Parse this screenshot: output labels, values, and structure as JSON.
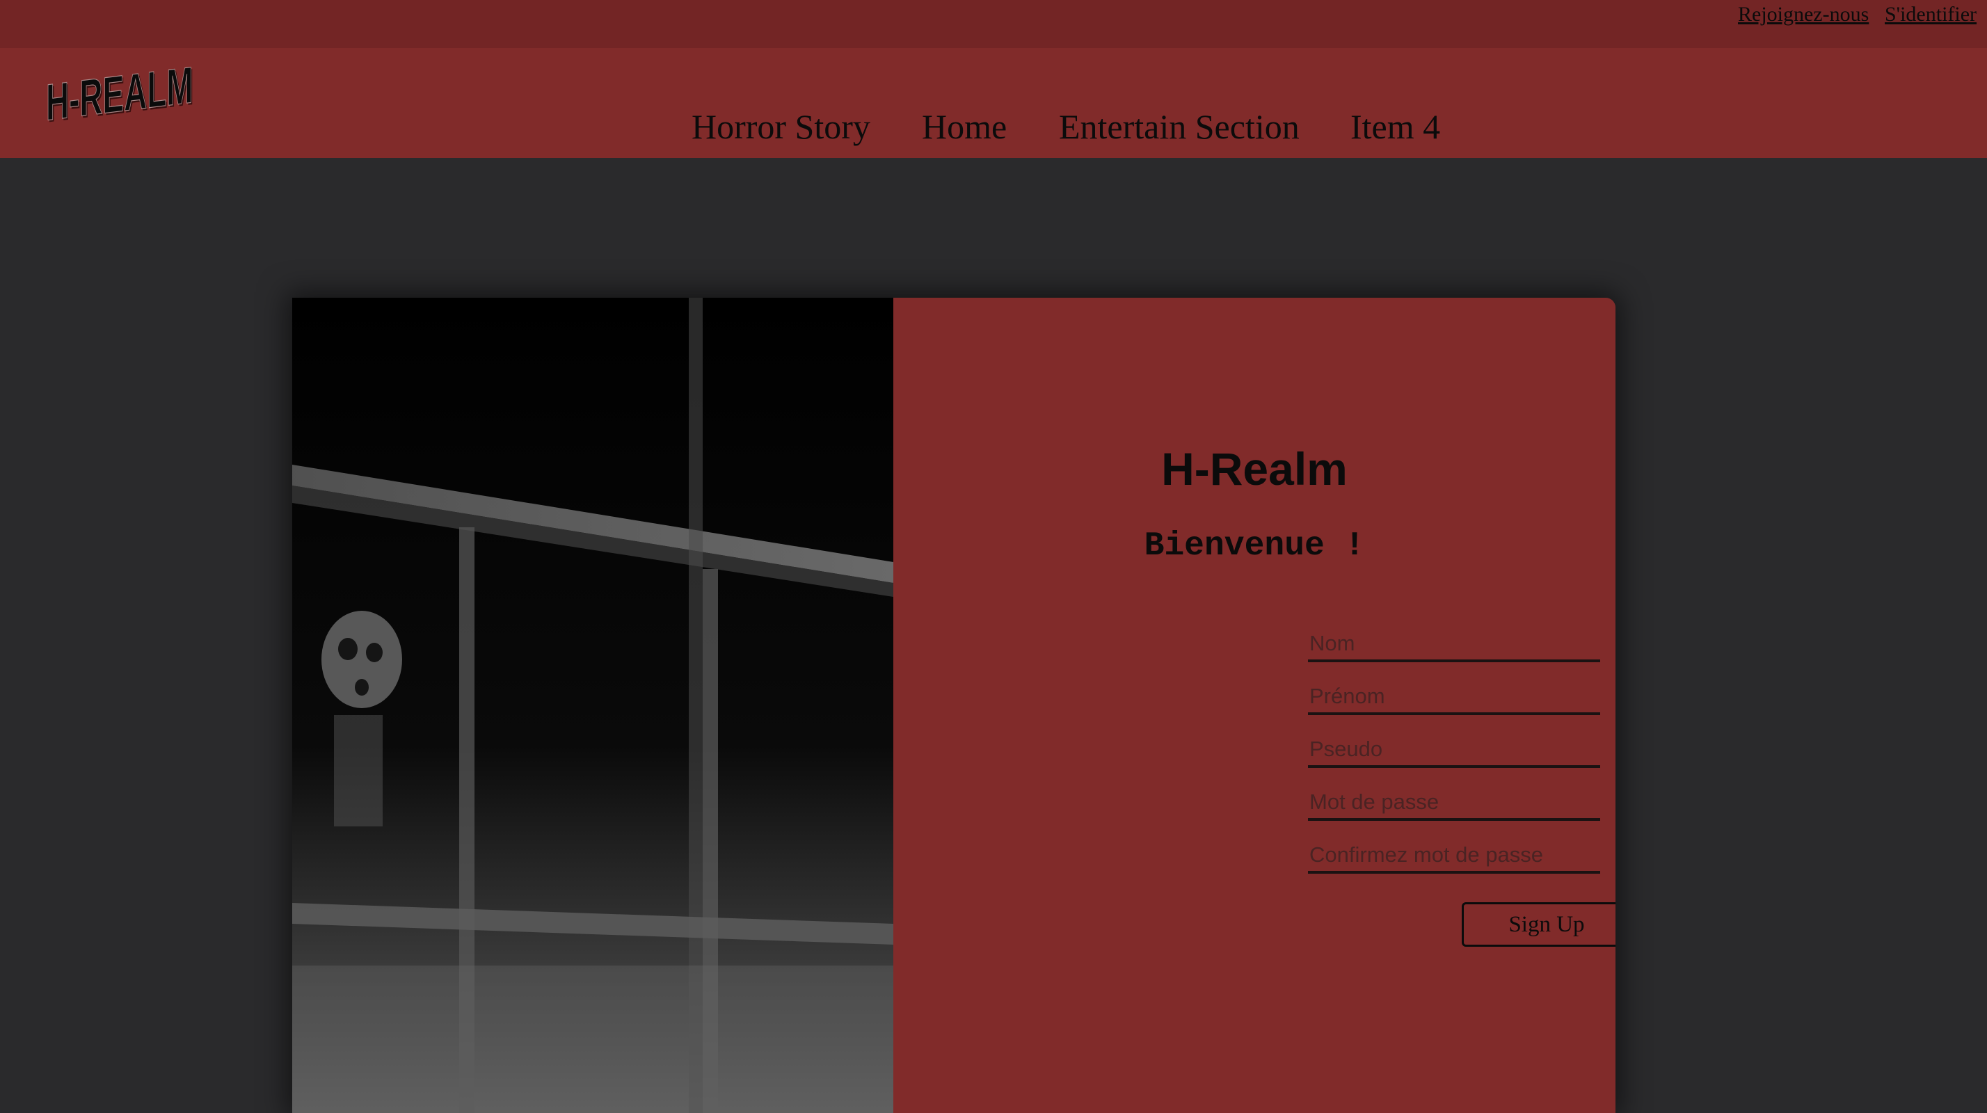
{
  "topbar": {
    "join_label": "Rejoignez-nous",
    "login_label": "S'identifier"
  },
  "header": {
    "logo_text": "H-REALM",
    "nav": [
      "Horror Story",
      "Home",
      "Entertain Section",
      "Item 4"
    ]
  },
  "form": {
    "title": "H-Realm",
    "welcome": "Bienvenue !",
    "fields": {
      "nom": {
        "placeholder": "Nom",
        "value": ""
      },
      "prenom": {
        "placeholder": "Prénom",
        "value": ""
      },
      "pseudo": {
        "placeholder": "Pseudo",
        "value": ""
      },
      "password": {
        "placeholder": "Mot de passe",
        "value": ""
      },
      "confirm": {
        "placeholder": "Confirmez mot de passe",
        "value": ""
      }
    },
    "submit_label": "Sign Up"
  },
  "colors": {
    "topbar": "#732525",
    "header": "#812b2a",
    "background": "#2a2a2c",
    "form_panel": "#812b2a",
    "text": "#0b0b0b"
  },
  "images": {
    "side_image": "dark-window-ghost-image"
  }
}
